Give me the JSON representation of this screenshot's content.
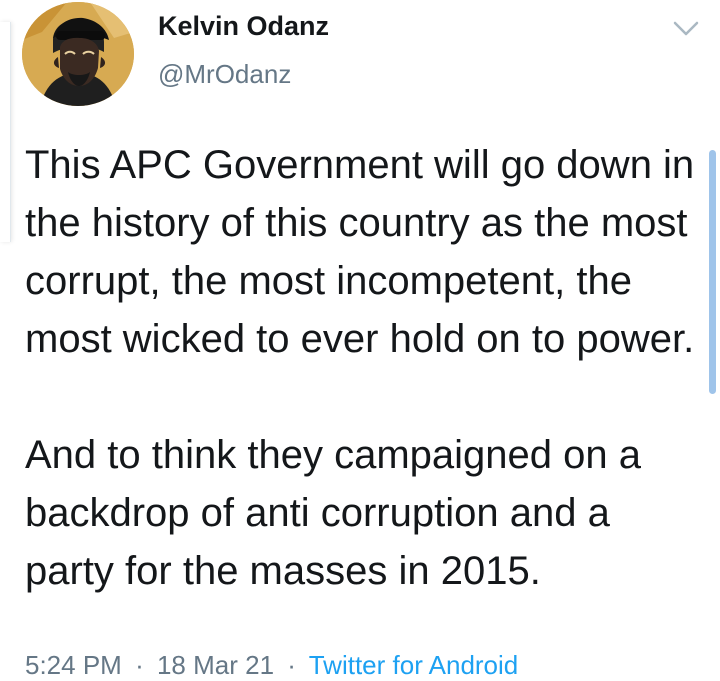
{
  "tweet": {
    "display_name": "Kelvin Odanz",
    "handle": "@MrOdanz",
    "text": "This APC Government will go down in the history of this country as the most corrupt, the most incompetent, the most wicked to ever hold on to power.\n\nAnd to think they campaigned on a backdrop of anti corruption and a party for the masses in 2015.",
    "time": "5:24 PM",
    "separator": "·",
    "date": "18 Mar 21",
    "source": "Twitter for Android"
  },
  "icons": {
    "menu": "chevron-down-icon",
    "avatar": "avatar"
  },
  "colors": {
    "text": "#14171a",
    "secondary": "#657786",
    "link": "#1da1f2",
    "avatar_background": "#d7aa52",
    "scrollbar": "#9fc4ea"
  }
}
